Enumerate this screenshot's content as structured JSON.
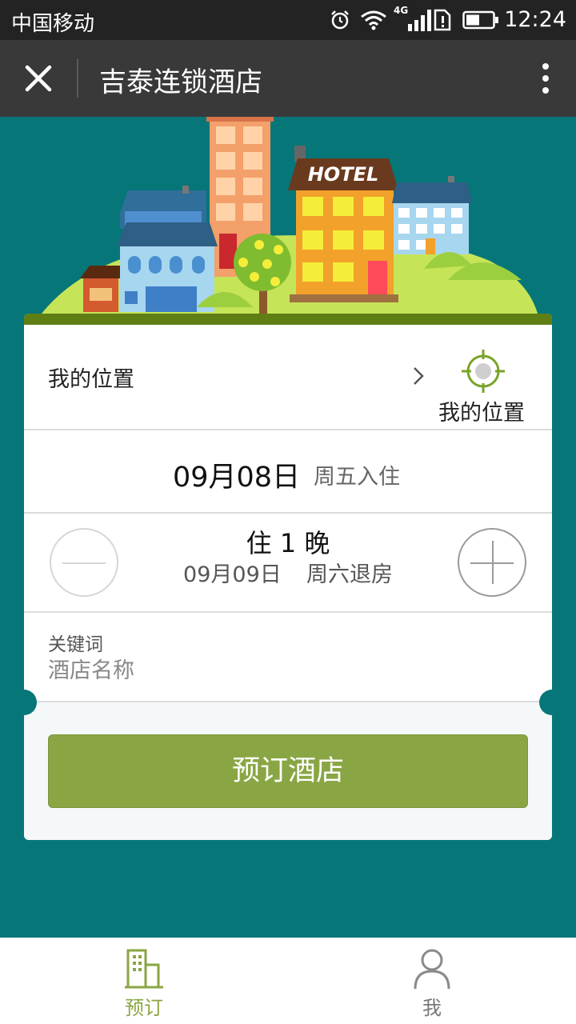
{
  "status_bar": {
    "carrier": "中国移动",
    "network": "4G",
    "time": "12:24"
  },
  "title_bar": {
    "title": "吉泰连锁酒店"
  },
  "illustration": {
    "hotel_sign": "HOTEL"
  },
  "booking": {
    "location_label": "我的位置",
    "locate_button_label": "我的位置",
    "checkin_date": "09月08日",
    "checkin_weekday": "周五入住",
    "nights_text": "住 1 晚",
    "checkout_date": "09月09日",
    "checkout_weekday": "周六退房",
    "keyword_label": "关键词",
    "keyword_placeholder": "酒店名称",
    "keyword_value": "",
    "book_button": "预订酒店"
  },
  "tab_bar": {
    "tabs": [
      {
        "label": "预订",
        "icon": "building-icon",
        "active": true
      },
      {
        "label": "我",
        "icon": "person-icon",
        "active": false
      }
    ]
  },
  "colors": {
    "teal_background": "#067679",
    "accent_green": "#8aa644",
    "dark_bar": "#393939"
  }
}
